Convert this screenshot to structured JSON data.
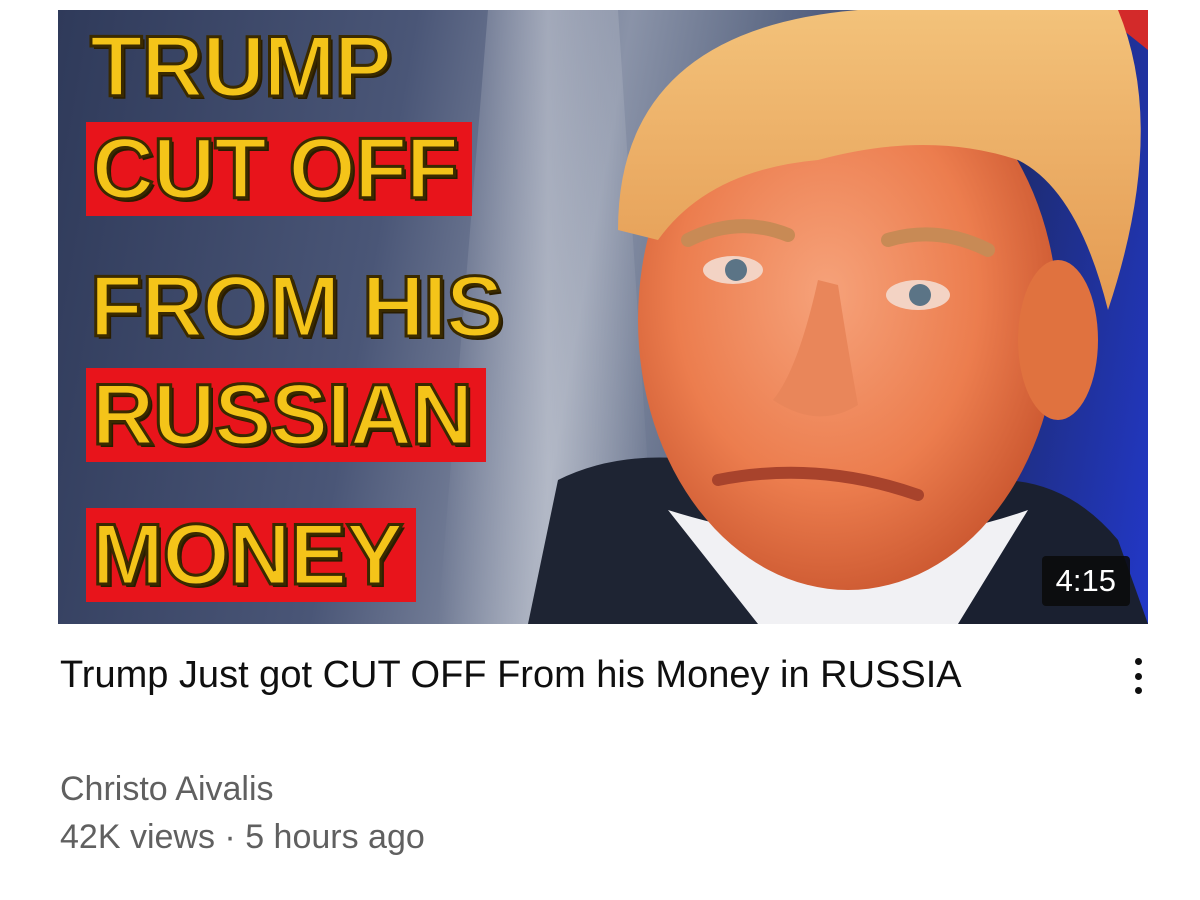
{
  "video": {
    "thumbnail": {
      "headline_lines": [
        "TRUMP",
        "CUT OFF",
        "FROM HIS",
        "RUSSIAN",
        "MONEY"
      ],
      "highlight_color": "#e8141b",
      "text_color": "#f4c419"
    },
    "duration": "4:15",
    "title": "Trump Just got CUT OFF From his Money in RUSSIA",
    "channel": "Christo Aivalis",
    "views": "42K views",
    "separator": "·",
    "age": "5 hours ago",
    "menu_icon": "more-vert-icon"
  }
}
